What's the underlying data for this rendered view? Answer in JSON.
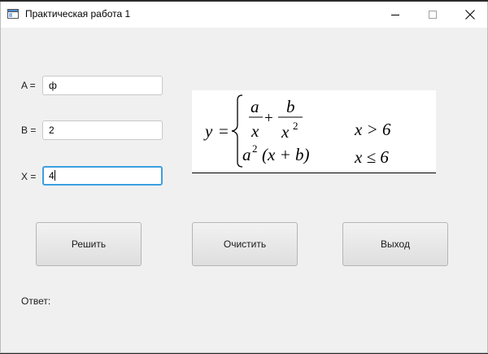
{
  "window": {
    "title": "Практическая работа 1"
  },
  "form": {
    "a": {
      "label": "A =",
      "value": "ф"
    },
    "b": {
      "label": "B =",
      "value": "2"
    },
    "x": {
      "label": "X =",
      "value": "4"
    }
  },
  "buttons": {
    "solve": "Решить",
    "clear": "Очистить",
    "exit": "Выход"
  },
  "answer_label": "Ответ:",
  "formula": {
    "y": "y",
    "eq": "=",
    "case1_num1": "a",
    "case1_den1": "x",
    "plus": "+",
    "case1_num2": "b",
    "case1_den2": "x",
    "exp": "2",
    "cond1": "x > 6",
    "case2_a": "a",
    "case2_exp": "2",
    "case2_rest": "(x + b)",
    "cond2": "x ≤ 6"
  },
  "colors": {
    "focus_border": "#3c9fe0",
    "window_bg": "#f0f0f0"
  }
}
